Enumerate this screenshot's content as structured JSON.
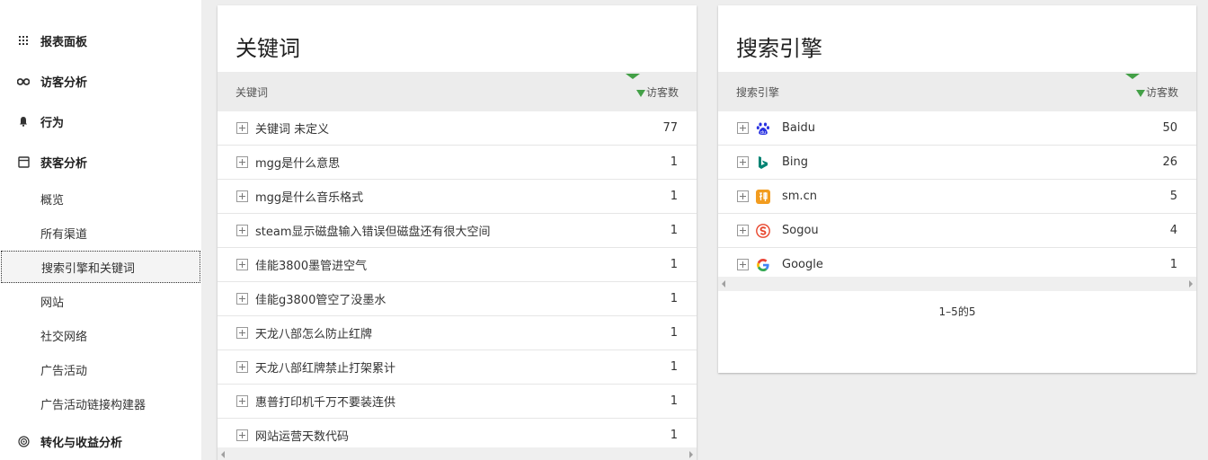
{
  "sidebar": {
    "categories": [
      {
        "label": "报表面板",
        "icon": "dashboard-icon"
      },
      {
        "label": "访客分析",
        "icon": "binoculars-icon"
      },
      {
        "label": "行为",
        "icon": "bell-icon"
      },
      {
        "label": "获客分析",
        "icon": "acquisition-icon"
      },
      {
        "label": "转化与收益分析",
        "icon": "target-icon"
      }
    ],
    "subitems": [
      {
        "label": "概览"
      },
      {
        "label": "所有渠道"
      },
      {
        "label": "搜索引擎和关键词",
        "active": true
      },
      {
        "label": "网站"
      },
      {
        "label": "社交网络"
      },
      {
        "label": "广告活动"
      },
      {
        "label": "广告活动链接构建器"
      }
    ]
  },
  "keywords": {
    "title": "关键词",
    "col_label": "关键词",
    "col_value": "访客数",
    "rows": [
      {
        "label": "关键词 未定义",
        "value": "77"
      },
      {
        "label": "mgg是什么意思",
        "value": "1"
      },
      {
        "label": "mgg是什么音乐格式",
        "value": "1"
      },
      {
        "label": "steam显示磁盘输入错误但磁盘还有很大空间",
        "value": "1"
      },
      {
        "label": "佳能3800墨管进空气",
        "value": "1"
      },
      {
        "label": "佳能g3800管空了没墨水",
        "value": "1"
      },
      {
        "label": "天龙八部怎么防止红牌",
        "value": "1"
      },
      {
        "label": "天龙八部红牌禁止打架累计",
        "value": "1"
      },
      {
        "label": "惠普打印机千万不要装连供",
        "value": "1"
      },
      {
        "label": "网站运营天数代码",
        "value": "1"
      }
    ]
  },
  "engines": {
    "title": "搜索引擎",
    "col_label": "搜索引擎",
    "col_value": "访客数",
    "rows": [
      {
        "label": "Baidu",
        "value": "50",
        "icon": "baidu-icon"
      },
      {
        "label": "Bing",
        "value": "26",
        "icon": "bing-icon"
      },
      {
        "label": "sm.cn",
        "value": "5",
        "icon": "sm-cn-icon"
      },
      {
        "label": "Sogou",
        "value": "4",
        "icon": "sogou-icon"
      },
      {
        "label": "Google",
        "value": "1",
        "icon": "google-icon"
      }
    ],
    "pagination": "1–5的5"
  },
  "colors": {
    "sort_indicator": "#43a047",
    "baidu": "#2932e1",
    "bing": "#008373",
    "sm_cn": "#f29c1f",
    "sogou": "#e8452c"
  }
}
